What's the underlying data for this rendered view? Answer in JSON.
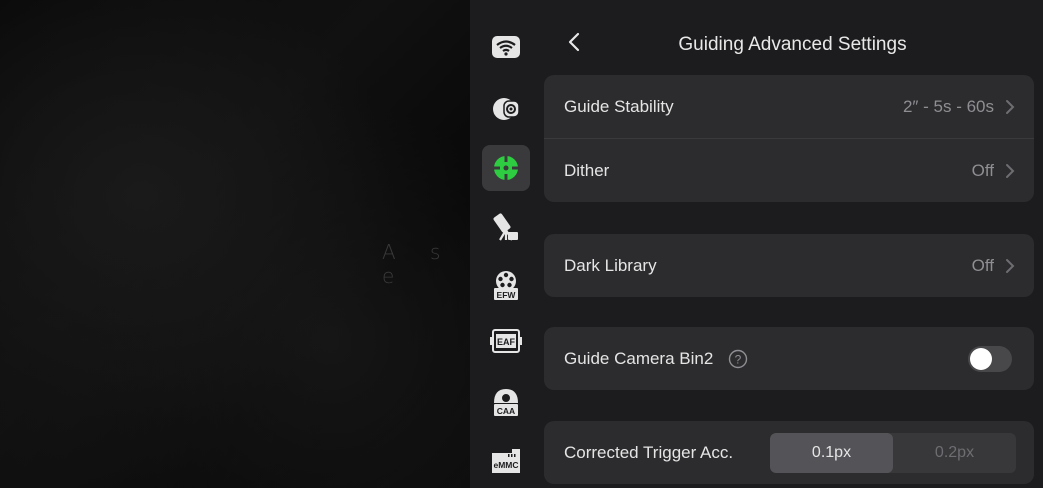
{
  "background": {
    "overlay_text": "A s e"
  },
  "rail": {
    "items": [
      {
        "icon": "wifi-icon",
        "active": false
      },
      {
        "icon": "camera-icon",
        "active": false
      },
      {
        "icon": "guiding-crosshair-icon",
        "active": true,
        "accent": "#2ecc40"
      },
      {
        "icon": "telescope-mount-icon",
        "active": false
      },
      {
        "icon": "efw-icon",
        "label": "EFW",
        "active": false
      },
      {
        "icon": "eaf-icon",
        "label": "EAF",
        "active": false
      },
      {
        "icon": "caa-icon",
        "label": "CAA",
        "active": false
      },
      {
        "icon": "emmc-icon",
        "label": "eMMC",
        "active": false
      }
    ]
  },
  "header": {
    "title": "Guiding Advanced Settings"
  },
  "settings": {
    "guide_stability": {
      "label": "Guide Stability",
      "value": "2″ - 5s - 60s"
    },
    "dither": {
      "label": "Dither",
      "value": "Off"
    },
    "dark_library": {
      "label": "Dark Library",
      "value": "Off"
    },
    "guide_camera_bin2": {
      "label": "Guide Camera Bin2",
      "enabled": false
    },
    "corrected_trigger": {
      "label": "Corrected Trigger Acc.",
      "options": [
        "0.1px",
        "0.2px"
      ],
      "selected": "0.1px"
    }
  },
  "colors": {
    "panel_bg": "#1c1c1e",
    "group_bg": "#2c2c2e",
    "accent_green": "#2ecc40"
  }
}
